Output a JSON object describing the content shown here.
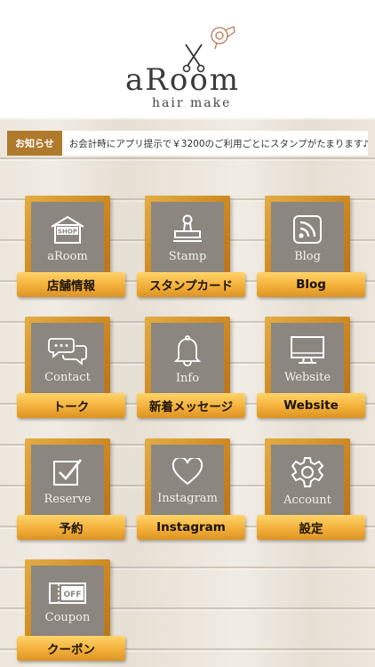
{
  "header": {
    "logo_main": "aRoom",
    "logo_sub": "hair make"
  },
  "notice": {
    "badge": "お知らせ",
    "text": "お会計時にアプリ提示で￥3200のご利用ごとにスタンプがたまります♪"
  },
  "menu": [
    {
      "icon": "shop-icon",
      "icon_text": "SHOP",
      "label": "aRoom",
      "button": "店舗情報"
    },
    {
      "icon": "stamp-icon",
      "label": "Stamp",
      "button": "スタンプカード"
    },
    {
      "icon": "rss-icon",
      "label": "Blog",
      "button": "Blog"
    },
    {
      "icon": "chat-icon",
      "label": "Contact",
      "button": "トーク"
    },
    {
      "icon": "bell-icon",
      "label": "Info",
      "button": "新着メッセージ"
    },
    {
      "icon": "monitor-icon",
      "label": "Website",
      "button": "Website"
    },
    {
      "icon": "checkbox-icon",
      "label": "Reserve",
      "button": "予約"
    },
    {
      "icon": "heart-icon",
      "label": "Instagram",
      "button": "Instagram"
    },
    {
      "icon": "gear-icon",
      "label": "Account",
      "button": "設定"
    },
    {
      "icon": "coupon-icon",
      "icon_text": "OFF",
      "label": "Coupon",
      "button": "クーポン"
    }
  ],
  "colors": {
    "badge": "#b07a2c",
    "frame": "#cf8a22",
    "ribbon": "#f3b03a",
    "panel": "#8b8680"
  }
}
